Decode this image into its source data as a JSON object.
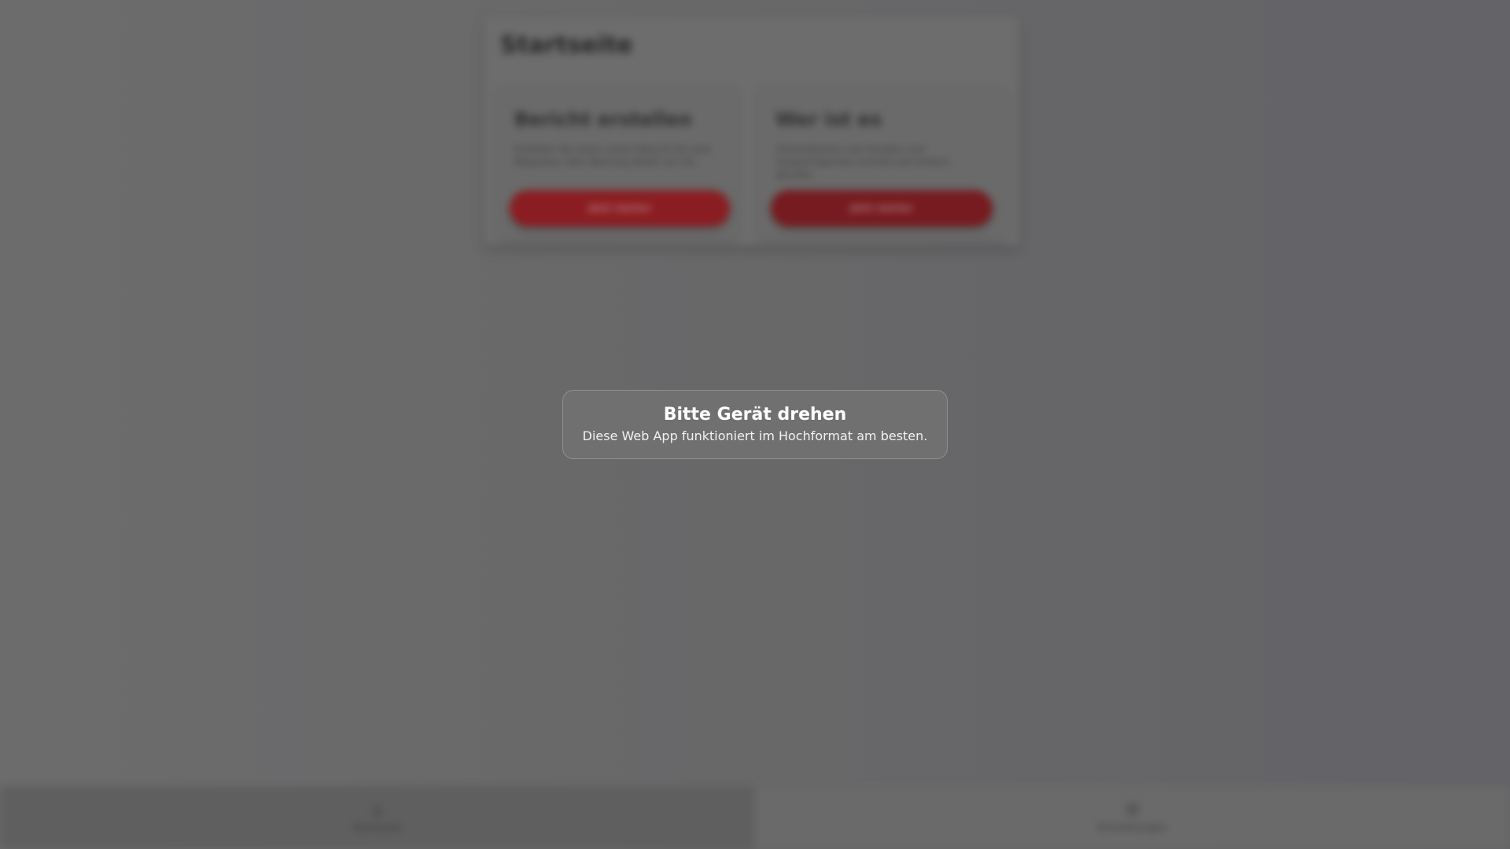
{
  "app": {
    "page_title": "Startseite",
    "cards": [
      {
        "title": "Bericht erstellen",
        "text": "Erstellen Sie einen neuen Bericht für eine Reparatur oder Wartung direkt vor Ort.",
        "button_label": "Jetzt starten"
      },
      {
        "title": "Wer ist es",
        "text": "Informationen zum Kunden und Ansprechpartner schnell und einfach abrufen.",
        "button_label": "Jetzt starten"
      }
    ]
  },
  "bottom_nav": {
    "items": [
      {
        "label": "Startseite",
        "icon": "home-icon",
        "glyph": "⌂"
      },
      {
        "label": "Einstellungen",
        "icon": "gear-icon",
        "glyph": "⚙"
      }
    ]
  },
  "overlay": {
    "title": "Bitte Gerät drehen",
    "message": "Diese Web App funktioniert im Hochformat am besten."
  },
  "colors": {
    "accent": "#8a1d22",
    "backdrop": "#6a6a6b"
  }
}
